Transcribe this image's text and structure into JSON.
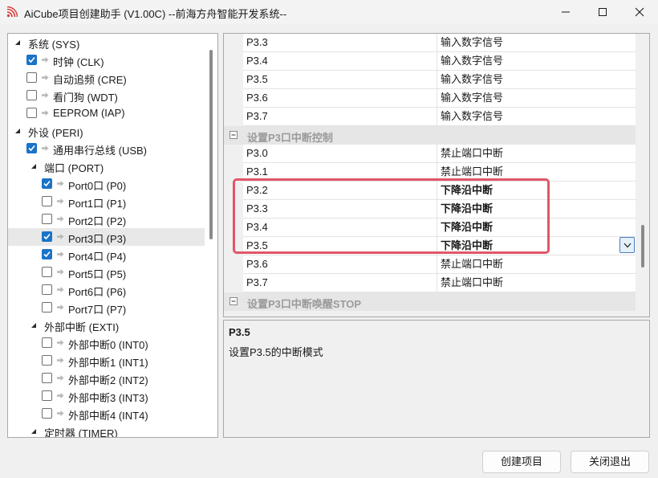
{
  "window": {
    "title": "AiCube项目创建助手 (V1.00C) --前海方舟智能开发系统--",
    "icon": "wifi-icon",
    "controls": [
      "minimize-icon",
      "maximize-icon",
      "close-icon"
    ]
  },
  "tree": [
    {
      "label": "系统 (SYS)",
      "level": 0,
      "expanded": true,
      "checkbox": false
    },
    {
      "label": "时钟 (CLK)",
      "level": 1,
      "checkbox": true,
      "checked": true
    },
    {
      "label": "自动追频 (CRE)",
      "level": 1,
      "checkbox": true,
      "checked": false
    },
    {
      "label": "看门狗 (WDT)",
      "level": 1,
      "checkbox": true,
      "checked": false
    },
    {
      "label": "EEPROM (IAP)",
      "level": 1,
      "checkbox": true,
      "checked": false
    },
    {
      "label": "外设 (PERI)",
      "level": 0,
      "expanded": true,
      "checkbox": false
    },
    {
      "label": "通用串行总线 (USB)",
      "level": 1,
      "checkbox": true,
      "checked": true
    },
    {
      "label": "端口 (PORT)",
      "level": 1,
      "expanded": true,
      "checkbox": false
    },
    {
      "label": "Port0口 (P0)",
      "level": 2,
      "checkbox": true,
      "checked": true
    },
    {
      "label": "Port1口 (P1)",
      "level": 2,
      "checkbox": true,
      "checked": false
    },
    {
      "label": "Port2口 (P2)",
      "level": 2,
      "checkbox": true,
      "checked": false
    },
    {
      "label": "Port3口 (P3)",
      "level": 2,
      "checkbox": true,
      "checked": true,
      "selected": true
    },
    {
      "label": "Port4口 (P4)",
      "level": 2,
      "checkbox": true,
      "checked": true
    },
    {
      "label": "Port5口 (P5)",
      "level": 2,
      "checkbox": true,
      "checked": false
    },
    {
      "label": "Port6口 (P6)",
      "level": 2,
      "checkbox": true,
      "checked": false
    },
    {
      "label": "Port7口 (P7)",
      "level": 2,
      "checkbox": true,
      "checked": false
    },
    {
      "label": "外部中断 (EXTI)",
      "level": 1,
      "expanded": true,
      "checkbox": false
    },
    {
      "label": "外部中断0 (INT0)",
      "level": 2,
      "checkbox": true,
      "checked": false
    },
    {
      "label": "外部中断1 (INT1)",
      "level": 2,
      "checkbox": true,
      "checked": false
    },
    {
      "label": "外部中断2 (INT2)",
      "level": 2,
      "checkbox": true,
      "checked": false
    },
    {
      "label": "外部中断3 (INT3)",
      "level": 2,
      "checkbox": true,
      "checked": false
    },
    {
      "label": "外部中断4 (INT4)",
      "level": 2,
      "checkbox": true,
      "checked": false
    },
    {
      "label": "定时器 (TIMER)",
      "level": 1,
      "expanded": true,
      "checkbox": false
    }
  ],
  "grid": {
    "rows": [
      {
        "type": "prop",
        "name": "P3.3",
        "value": "输入数字信号"
      },
      {
        "type": "prop",
        "name": "P3.4",
        "value": "输入数字信号"
      },
      {
        "type": "prop",
        "name": "P3.5",
        "value": "输入数字信号"
      },
      {
        "type": "prop",
        "name": "P3.6",
        "value": "输入数字信号"
      },
      {
        "type": "prop",
        "name": "P3.7",
        "value": "输入数字信号"
      },
      {
        "type": "category",
        "name": "设置P3口中断控制"
      },
      {
        "type": "prop",
        "name": "P3.0",
        "value": "禁止端口中断"
      },
      {
        "type": "prop",
        "name": "P3.1",
        "value": "禁止端口中断"
      },
      {
        "type": "prop",
        "name": "P3.2",
        "value": "下降沿中断",
        "bold": true
      },
      {
        "type": "prop",
        "name": "P3.3",
        "value": "下降沿中断",
        "bold": true
      },
      {
        "type": "prop",
        "name": "P3.4",
        "value": "下降沿中断",
        "bold": true
      },
      {
        "type": "prop",
        "name": "P3.5",
        "value": "下降沿中断",
        "bold": true,
        "selected": true
      },
      {
        "type": "prop",
        "name": "P3.6",
        "value": "禁止端口中断"
      },
      {
        "type": "prop",
        "name": "P3.7",
        "value": "禁止端口中断"
      },
      {
        "type": "category",
        "name": "设置P3口中断唤醒STOP"
      }
    ]
  },
  "description": {
    "title": "P3.5",
    "text": "设置P3.5的中断模式"
  },
  "buttons": {
    "create": "创建项目",
    "close": "关闭退出"
  },
  "colors": {
    "checkbox": "#1a73c8",
    "highlight": "#e0566a",
    "accent_icon": "#d93a3a"
  }
}
